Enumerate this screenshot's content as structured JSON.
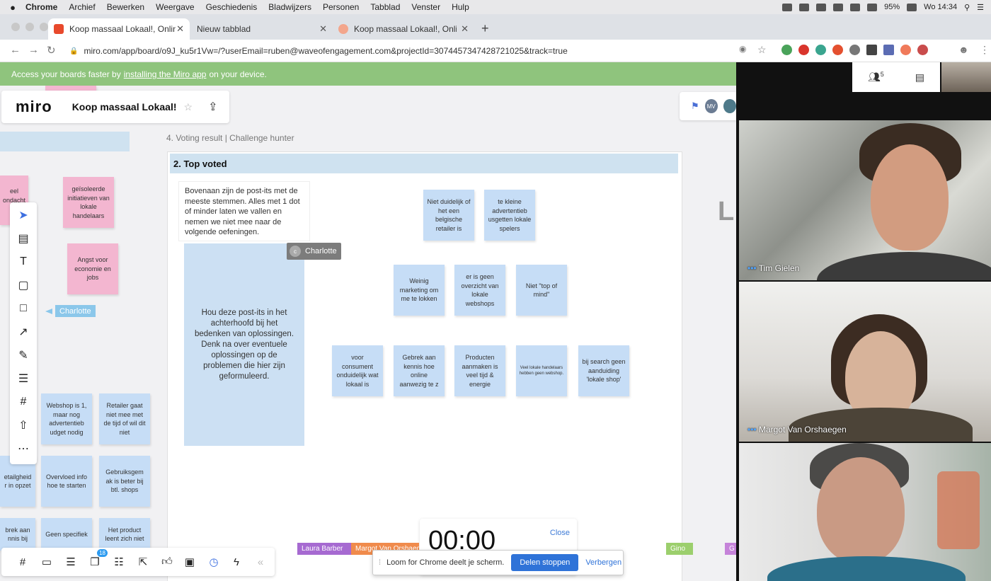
{
  "menubar": {
    "apple": "",
    "items": [
      "Chrome",
      "Archief",
      "Bewerken",
      "Weergave",
      "Geschiedenis",
      "Bladwijzers",
      "Personen",
      "Tabblad",
      "Venster",
      "Hulp"
    ],
    "battery": "95%",
    "clock": "Wo 14:34"
  },
  "tabs": [
    {
      "title": "Koop massaal Lokaal!, Online \\",
      "favicon_color": "#e8492c"
    },
    {
      "title": "Nieuw tabblad",
      "favicon_color": ""
    },
    {
      "title": "Koop massaal Lokaal!, Online \\",
      "favicon_color": "#f3a68c"
    }
  ],
  "address": {
    "url": "miro.com/app/board/o9J_ku5r1Vw=/?userEmail=ruben@waveofengagement.com&projectId=3074457347428721025&track=true"
  },
  "banner": {
    "text_before": "Access your boards faster by",
    "link": "installing the Miro app",
    "text_after": "on your device."
  },
  "board": {
    "logo": "miro",
    "title": "Koop massaal Lokaal!",
    "avatar_initials": "MV",
    "frame_caption": "4. Voting result | Challenge hunter",
    "frame_title": "2. Top voted",
    "description": "Bovenaan zijn de post-its met de meeste stemmen. Alles met 1 dot of minder laten we vallen en nemen we niet mee naar de volgende oefeningen.",
    "big_postit": "Hou deze post-its in het achterhoofd bij het bedenken van oplossingen. Denk na over eventuele oplossingen op de problemen die hier zijn geformuleerd.",
    "cursor_charlotte": "Charlotte",
    "cursor_charlotte_initial": "c",
    "cursor_charlotte2": "Charlotte",
    "right_letter": "L"
  },
  "postits_voted": [
    "Niet duidelijk of het een belgische retailer is",
    "te kleine advertentieb usgetten lokale spelers",
    "Weinig marketing om me te lokken",
    "er is geen overzicht van lokale webshops",
    "Niet \"top of mind\"",
    "voor consument onduidelijk wat lokaal is",
    "Gebrek aan kennis hoe online aanwezig te z",
    "Producten aanmaken is veel tijd & energie",
    "Veel lokale handelaars hebben geen webshop.",
    "bij search geen aanduiding 'lokale shop'"
  ],
  "postits_left": [
    {
      "text": "eel ondacht r",
      "color": "pink"
    },
    {
      "text": "geïsoleerde initiatieven van lokale handelaars",
      "color": "pink"
    },
    {
      "text": "Angst voor economie en jobs",
      "color": "pink"
    },
    {
      "text": "Webshop is 1, maar nog advertentieb udget nodig",
      "color": "blue"
    },
    {
      "text": "Retailer gaat niet mee met de tijd of wil dit niet",
      "color": "blue"
    },
    {
      "text": "etailgheid r in opzet",
      "color": "blue"
    },
    {
      "text": "Overvloed info hoe te starten",
      "color": "blue"
    },
    {
      "text": "Gebruiksgem ak is beter bij btl. shops",
      "color": "blue"
    },
    {
      "text": "brek aan nnis bij",
      "color": "blue"
    },
    {
      "text": "Geen specifiek",
      "color": "blue"
    },
    {
      "text": "Het product leent zich niet",
      "color": "blue"
    }
  ],
  "left_toolbar": [
    "select-icon",
    "template-icon",
    "text-icon",
    "sticky-note-icon",
    "shape-icon",
    "arrow-icon",
    "pen-icon",
    "comment-icon",
    "frame-icon",
    "upload-icon",
    "more-icon"
  ],
  "bottom_toolbar": {
    "badge": "18",
    "collapse": "«"
  },
  "timer": {
    "time": "00:00",
    "close": "Close"
  },
  "loom": {
    "message": "Loom for Chrome deelt je scherm.",
    "stop": "Delen stoppen",
    "hide": "Verbergen"
  },
  "nametags": [
    {
      "name": "Laura Barber",
      "color": "#a66ad1"
    },
    {
      "name": "Margot Van Orshaegen",
      "color": "#f08b4c"
    },
    {
      "name": "Gino",
      "color": "#9ccf6d"
    },
    {
      "name": "G",
      "color": "#c583d9"
    }
  ],
  "video": {
    "participants_count": "5",
    "participants": [
      "Tim Gielen",
      "Margot Van Orshaegen",
      ""
    ]
  }
}
